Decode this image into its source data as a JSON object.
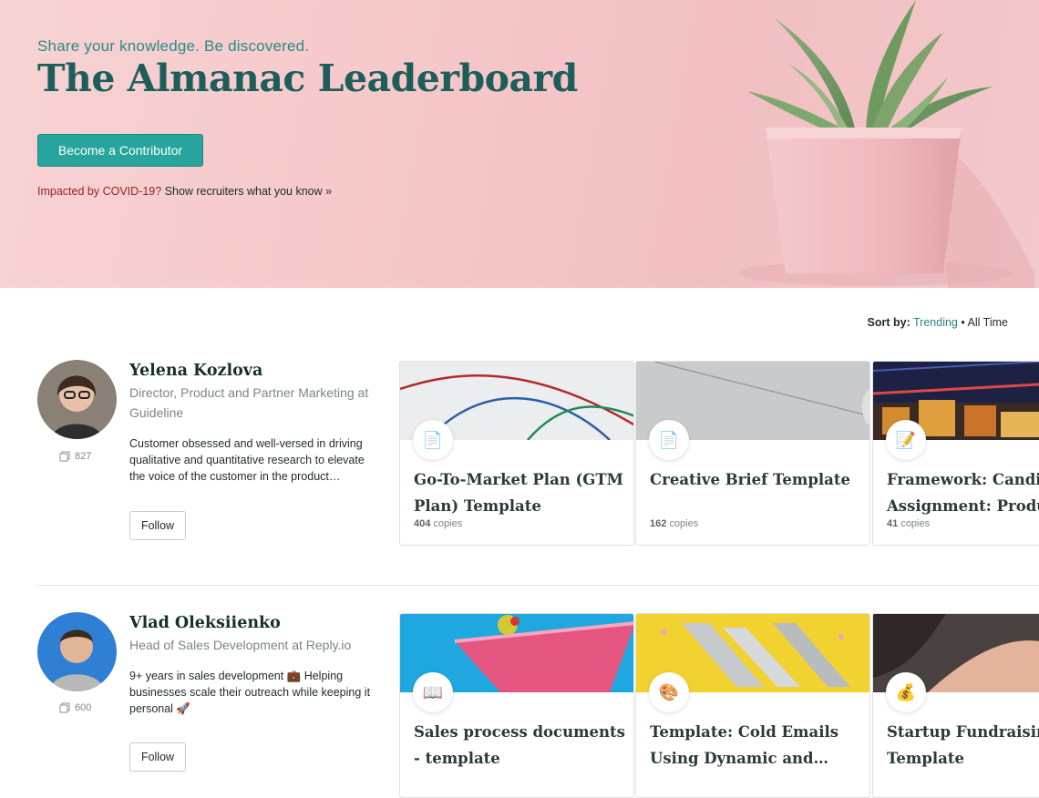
{
  "hero": {
    "tagline": "Share your knowledge. Be discovered.",
    "title": "The Almanac Leaderboard",
    "cta_label": "Become a Contributor",
    "covid_prefix": "Impacted by COVID-19?",
    "covid_link": "Show recruiters what you know »"
  },
  "sort": {
    "label": "Sort by:",
    "active": "Trending",
    "separator": "•",
    "other": "All Time"
  },
  "contributors": [
    {
      "name": "Yelena Kozlova",
      "role": "Director, Product and Partner Marketing at Guideline",
      "bio": "Customer obsessed and well-versed in driving qualitative and quantitative research to elevate the voice of the customer in the product marketing process.",
      "copies": "827",
      "follow_label": "Follow",
      "docs": [
        {
          "icon": "document-icon",
          "emoji": "📄",
          "title": "Go-To-Market Plan (GTM Plan) Template",
          "copies": "404",
          "copies_label": "copies"
        },
        {
          "icon": "document-icon",
          "emoji": "📄",
          "title": "Creative Brief Template",
          "copies": "162",
          "copies_label": "copies"
        },
        {
          "icon": "memo-icon",
          "emoji": "📝",
          "title": "Framework: Candidate Assignment: Product",
          "copies": "41",
          "copies_label": "copies"
        }
      ]
    },
    {
      "name": "Vlad Oleksiienko",
      "role": "Head of Sales Development at Reply.io",
      "bio": "9+ years in sales development 💼 Helping businesses scale their outreach while keeping it personal 🚀",
      "copies": "600",
      "follow_label": "Follow",
      "docs": [
        {
          "icon": "book-icon",
          "emoji": "📖",
          "title": "Sales process documents - template"
        },
        {
          "icon": "palette-icon",
          "emoji": "🎨",
          "title": "Template: Cold Emails Using Dynamic and…"
        },
        {
          "icon": "money-bag-icon",
          "emoji": "💰",
          "title": "Startup Fundraising Email Template"
        }
      ]
    }
  ],
  "colors": {
    "brand_teal": "#27a49c",
    "title_teal": "#1d5e5a",
    "hero_pink": "#f5c6c8",
    "warning_red": "#9b2121"
  }
}
